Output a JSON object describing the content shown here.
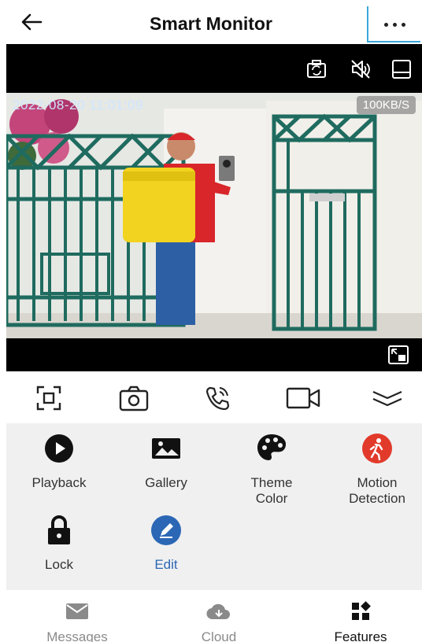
{
  "header": {
    "title": "Smart Monitor",
    "back_icon": "back-arrow-icon",
    "more_icon": "more-options-icon"
  },
  "video": {
    "timestamp": "2022-08-20 11:01:09",
    "bitrate": "100KB/S",
    "top_icons": [
      "screenshot-icon",
      "mute-icon",
      "layout-icon"
    ],
    "bottom_icons": [
      "picture-in-picture-icon"
    ]
  },
  "controls": [
    {
      "icon": "fullscreen-icon"
    },
    {
      "icon": "camera-icon"
    },
    {
      "icon": "call-icon"
    },
    {
      "icon": "video-record-icon"
    },
    {
      "icon": "collapse-icon"
    }
  ],
  "features": [
    {
      "label": "Playback",
      "icon": "play-icon"
    },
    {
      "label": "Gallery",
      "icon": "gallery-icon"
    },
    {
      "label": "Theme\nColor",
      "icon": "palette-icon"
    },
    {
      "label": "Motion\nDetection",
      "icon": "motion-detection-icon",
      "color": "#e23a2a"
    },
    {
      "label": "Lock",
      "icon": "lock-icon"
    },
    {
      "label": "Edit",
      "icon": "edit-icon",
      "color": "#2b67b5"
    }
  ],
  "bottom_nav": [
    {
      "label": "Messages",
      "icon": "mail-icon"
    },
    {
      "label": "Cloud",
      "icon": "cloud-icon"
    },
    {
      "label": "Features",
      "icon": "grid-icon",
      "active": true
    }
  ],
  "colors": {
    "accent_blue": "#2b67b5",
    "motion_red": "#e23a2a",
    "highlight_border": "#3aa7d9"
  }
}
